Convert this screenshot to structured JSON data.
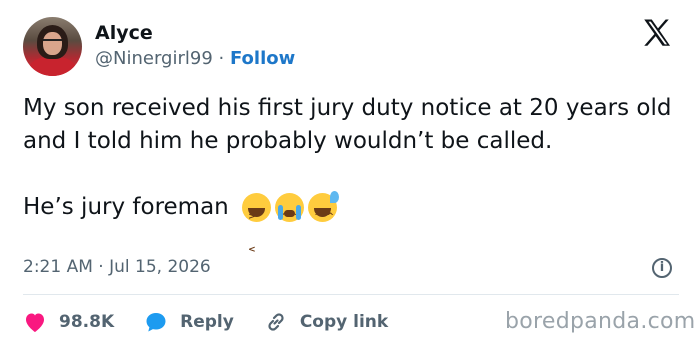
{
  "author": {
    "name": "Alyce",
    "handle": "@Ninergirl99",
    "separator": "·",
    "follow_label": "Follow"
  },
  "tweet": {
    "text": "My son received his first jury duty notice at 20 years old and I told him he probably wouldn’t be called.",
    "line2": "He’s jury foreman",
    "emojis": [
      "grinning-squinting-face",
      "loudly-crying-face",
      "grinning-face-with-sweat"
    ],
    "timestamp": "2:21 AM · Jul 15, 2026"
  },
  "actions": {
    "likes": "98.8K",
    "reply_label": "Reply",
    "copy_link_label": "Copy link"
  },
  "watermark": "boredpanda.com",
  "colors": {
    "heart": "#f91880",
    "reply": "#1d9bf0",
    "follow": "#1d77c9",
    "muted": "#536471"
  }
}
